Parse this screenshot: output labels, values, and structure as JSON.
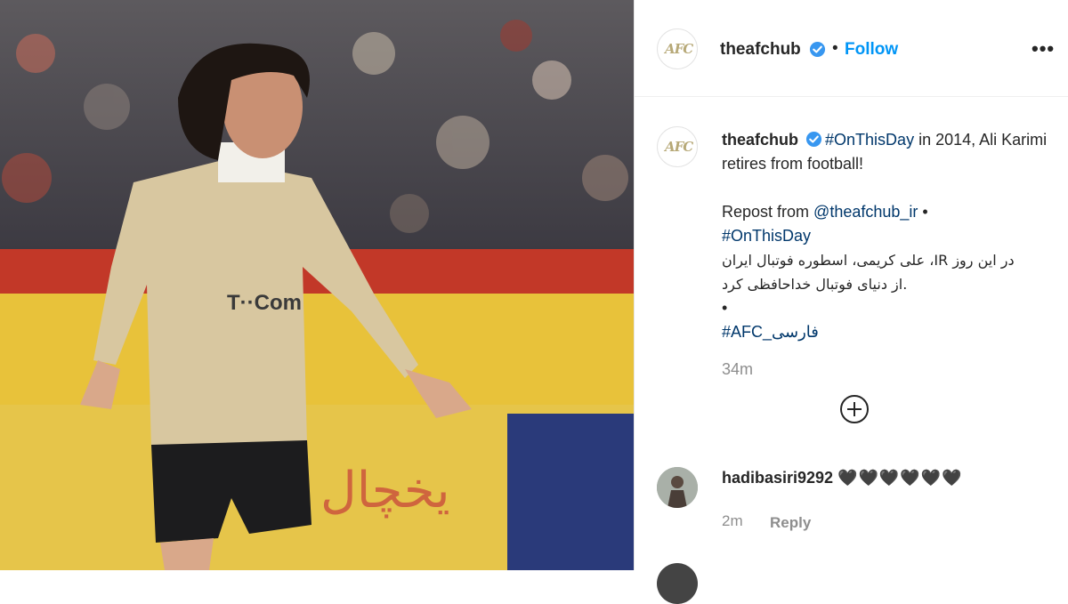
{
  "post": {
    "username": "theafchub",
    "follow_label": "Follow",
    "separator": "•",
    "more_label": "•••"
  },
  "caption": {
    "username": "theafchub",
    "hashtag1": "#OnThisDay",
    "text1": " in 2014, Ali Karimi retires from football!",
    "repost_prefix": "Repost from ",
    "repost_mention": "@theafchub_ir",
    "repost_suffix": " •",
    "hashtag2": "#OnThisDay",
    "farsi_line1": "در این روز IR، علی کریمی، اسطوره فوتبال ایران",
    "farsi_line2": ".از دنیای فوتبال خداحافظی کرد",
    "bullet": "•",
    "hashtag3": "#AFC_فارسی",
    "time": "34m"
  },
  "comment": {
    "username": "hadibasiri9292",
    "text": "🖤🖤🖤🖤🖤🖤",
    "time": "2m",
    "reply_label": "Reply"
  },
  "colors": {
    "link": "#00376b",
    "follow": "#0095f6",
    "verified": "#3897f0"
  }
}
